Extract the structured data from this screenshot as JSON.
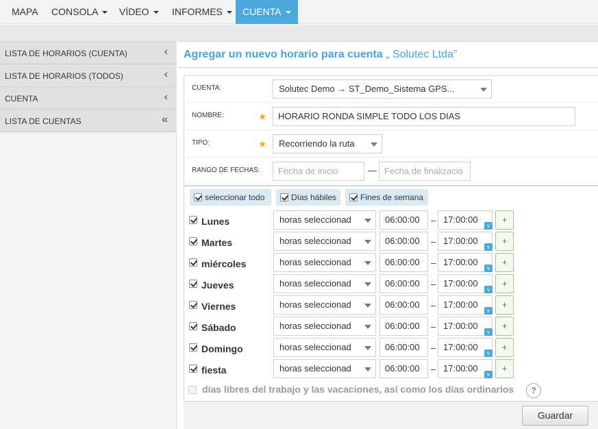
{
  "nav": {
    "items": [
      {
        "label": "MAPA",
        "has_caret": false
      },
      {
        "label": "CONSOLA",
        "has_caret": true
      },
      {
        "label": "VÍDEO",
        "has_caret": true
      },
      {
        "label": "INFORMES",
        "has_caret": true
      },
      {
        "label": "CUENTA",
        "has_caret": true,
        "active": true
      }
    ]
  },
  "sidebar": {
    "items": [
      {
        "label": "LISTA DE HORARIOS (CUENTA)",
        "icon": "‹"
      },
      {
        "label": "LISTA DE HORARIOS (TODOS)",
        "icon": "‹"
      },
      {
        "label": "CUENTA",
        "icon": "‹"
      },
      {
        "label": "LISTA DE CUENTAS",
        "icon": "«"
      }
    ]
  },
  "main": {
    "title": "Agregar un nuevo horario para cuenta",
    "title_suffix": "„ Solutec Ltda”"
  },
  "form": {
    "cuenta_label": "CUENTA:",
    "cuenta_value": "Solutec Demo → ST_Demo_Sistema GPS...",
    "nombre_label": "NOMBRE:",
    "nombre_value": "HORARIO RONDA SIMPLE TODO LOS DIAS",
    "tipo_label": "TIPO:",
    "tipo_value": "Recorriendo la ruta",
    "rango_label": "RANGO DE FECHAS:",
    "fecha_inicio_placeholder": "Fecha de inicio",
    "fecha_fin_placeholder": "Fecha de finalizació",
    "range_dash": "—",
    "required_mark": "★"
  },
  "chips": {
    "select_all": "seleccionar todo",
    "weekdays": "Días hábiles",
    "weekends": "Fines de semana"
  },
  "days": [
    {
      "name": "Lunes",
      "mode": "horas seleccionad",
      "start": "06:00:00",
      "end": "17:00:00"
    },
    {
      "name": "Martes",
      "mode": "horas seleccionad",
      "start": "06:00:00",
      "end": "17:00:00"
    },
    {
      "name": "miércoles",
      "mode": "horas seleccionad",
      "start": "06:00:00",
      "end": "17:00:00"
    },
    {
      "name": "Jueves",
      "mode": "horas seleccionad",
      "start": "06:00:00",
      "end": "17:00:00"
    },
    {
      "name": "Viernes",
      "mode": "horas seleccionad",
      "start": "06:00:00",
      "end": "17:00:00"
    },
    {
      "name": "Sábado",
      "mode": "horas seleccionad",
      "start": "06:00:00",
      "end": "17:00:00"
    },
    {
      "name": "Domingo",
      "mode": "horas seleccionad",
      "start": "06:00:00",
      "end": "17:00:00"
    },
    {
      "name": "fiesta",
      "mode": "horas seleccionad",
      "start": "06:00:00",
      "end": "17:00:00"
    }
  ],
  "day_ui": {
    "time_dash": "–",
    "v_badge": "v",
    "plus": "+"
  },
  "holiday_text": "días libres del trabajo y las vacaciones, así como los días ordinarios",
  "help_symbol": "?",
  "save_label": "Guardar",
  "colors": {
    "accent": "#4aa8db",
    "title": "#4aa3d6",
    "star": "#f0ad1e"
  }
}
